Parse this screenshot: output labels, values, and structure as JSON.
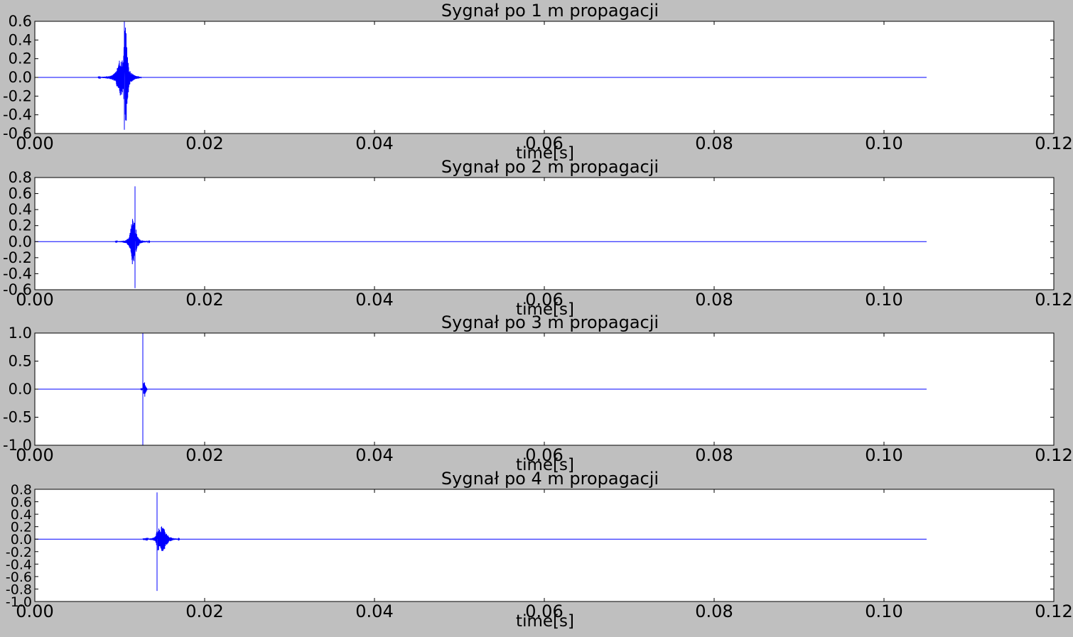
{
  "figure": {
    "background": "#bfbfbf",
    "axes_background": "#ffffff",
    "line_color": "#0000ff"
  },
  "chart_data": [
    {
      "type": "line",
      "title": "Sygnał po 1 m propagacji",
      "xlabel": "time[s]",
      "ylabel": "",
      "xlim": [
        0.0,
        0.12
      ],
      "ylim": [
        -0.6,
        0.6
      ],
      "xticks": [
        "0.00",
        "0.02",
        "0.04",
        "0.06",
        "0.08",
        "0.10",
        "0.12"
      ],
      "yticks": [
        "-0.6",
        "-0.4",
        "-0.2",
        "0.0",
        "0.2",
        "0.4",
        "0.6"
      ],
      "grid": false,
      "signal": {
        "t_start": 0.0,
        "t_end": 0.105,
        "baseline": 0.0,
        "burst": [
          [
            0.0075,
            0.003
          ],
          [
            0.0082,
            0.008
          ],
          [
            0.0088,
            0.015
          ],
          [
            0.0093,
            0.03
          ],
          [
            0.0096,
            0.07
          ],
          [
            0.0099,
            0.14
          ],
          [
            0.0101,
            0.2
          ],
          [
            0.0103,
            0.18
          ],
          [
            0.0105,
            0.15
          ],
          [
            0.0106,
            0.6
          ],
          [
            0.0107,
            0.58
          ],
          [
            0.0108,
            0.35
          ],
          [
            0.011,
            0.12
          ],
          [
            0.0113,
            0.05
          ],
          [
            0.0118,
            0.02
          ],
          [
            0.0125,
            0.005
          ]
        ],
        "peak": {
          "t": 0.0106,
          "max": 0.6,
          "min": -0.56
        }
      }
    },
    {
      "type": "line",
      "title": "Sygnał po 2 m propagacji",
      "xlabel": "time[s]",
      "ylabel": "",
      "xlim": [
        0.0,
        0.12
      ],
      "ylim": [
        -0.6,
        0.8
      ],
      "xticks": [
        "0.00",
        "0.02",
        "0.04",
        "0.06",
        "0.08",
        "0.10",
        "0.12"
      ],
      "yticks": [
        "-0.6",
        "-0.4",
        "-0.2",
        "0.0",
        "0.2",
        "0.4",
        "0.6",
        "0.8"
      ],
      "grid": false,
      "signal": {
        "t_start": 0.0,
        "t_end": 0.105,
        "baseline": 0.0,
        "burst": [
          [
            0.0095,
            0.003
          ],
          [
            0.0103,
            0.008
          ],
          [
            0.0108,
            0.02
          ],
          [
            0.0111,
            0.05
          ],
          [
            0.0113,
            0.12
          ],
          [
            0.0115,
            0.28
          ],
          [
            0.0116,
            0.3
          ],
          [
            0.0117,
            0.25
          ],
          [
            0.0118,
            0.2
          ],
          [
            0.0119,
            0.15
          ],
          [
            0.012,
            0.08
          ],
          [
            0.0123,
            0.03
          ],
          [
            0.0128,
            0.01
          ],
          [
            0.0135,
            0.004
          ]
        ],
        "peak": {
          "t": 0.0118,
          "max": 0.69,
          "min": -0.58
        }
      }
    },
    {
      "type": "line",
      "title": "Sygnał po 3 m propagacji",
      "xlabel": "time[s]",
      "ylabel": "",
      "xlim": [
        0.0,
        0.12
      ],
      "ylim": [
        -1.0,
        1.0
      ],
      "xticks": [
        "0.00",
        "0.02",
        "0.04",
        "0.06",
        "0.08",
        "0.10",
        "0.12"
      ],
      "yticks": [
        "-1.0",
        "-0.5",
        "0.0",
        "0.5",
        "1.0"
      ],
      "grid": false,
      "signal": {
        "t_start": 0.0,
        "t_end": 0.105,
        "baseline": 0.0,
        "burst": [
          [
            0.0125,
            0.003
          ],
          [
            0.0127,
            0.01
          ],
          [
            0.0128,
            0.05
          ],
          [
            0.0129,
            0.15
          ],
          [
            0.013,
            0.06
          ],
          [
            0.0132,
            0.01
          ]
        ],
        "peak": {
          "t": 0.0128,
          "max": 1.0,
          "min": -1.0
        }
      }
    },
    {
      "type": "line",
      "title": "Sygnał po 4 m propagacji",
      "xlabel": "time[s]",
      "ylabel": "",
      "xlim": [
        0.0,
        0.12
      ],
      "ylim": [
        -1.0,
        0.8
      ],
      "xticks": [
        "0.00",
        "0.02",
        "0.04",
        "0.06",
        "0.08",
        "0.10",
        "0.12"
      ],
      "yticks": [
        "-1.0",
        "-0.8",
        "-0.6",
        "-0.4",
        "-0.2",
        "0.0",
        "0.2",
        "0.4",
        "0.6",
        "0.8"
      ],
      "grid": false,
      "signal": {
        "t_start": 0.0,
        "t_end": 0.105,
        "baseline": 0.0,
        "burst": [
          [
            0.0128,
            0.003
          ],
          [
            0.0135,
            0.008
          ],
          [
            0.014,
            0.02
          ],
          [
            0.0143,
            0.05
          ],
          [
            0.0145,
            0.2
          ],
          [
            0.0146,
            0.16
          ],
          [
            0.0148,
            0.12
          ],
          [
            0.015,
            0.22
          ],
          [
            0.0152,
            0.18
          ],
          [
            0.0154,
            0.1
          ],
          [
            0.0158,
            0.04
          ],
          [
            0.0163,
            0.015
          ],
          [
            0.017,
            0.005
          ]
        ],
        "peak": {
          "t": 0.0144,
          "max": 0.75,
          "min": -0.83
        }
      }
    }
  ]
}
